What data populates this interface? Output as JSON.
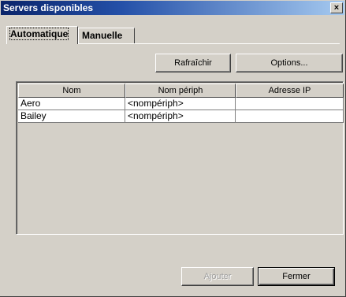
{
  "window": {
    "title": "Servers disponibles",
    "close_glyph": "×"
  },
  "tabs": [
    {
      "label": "Automatique",
      "active": true
    },
    {
      "label": "Manuelle",
      "active": false
    }
  ],
  "toolbar": {
    "refresh_label": "Rafraîchir",
    "options_label": "Options..."
  },
  "table": {
    "columns": [
      "Nom",
      "Nom périph",
      "Adresse IP"
    ],
    "rows": [
      [
        "Aero",
        "<nompériph>",
        ""
      ],
      [
        "Bailey",
        "<nompériph>",
        ""
      ]
    ]
  },
  "footer": {
    "add_label": "Ajouter",
    "add_enabled": false,
    "close_label": "Fermer"
  }
}
